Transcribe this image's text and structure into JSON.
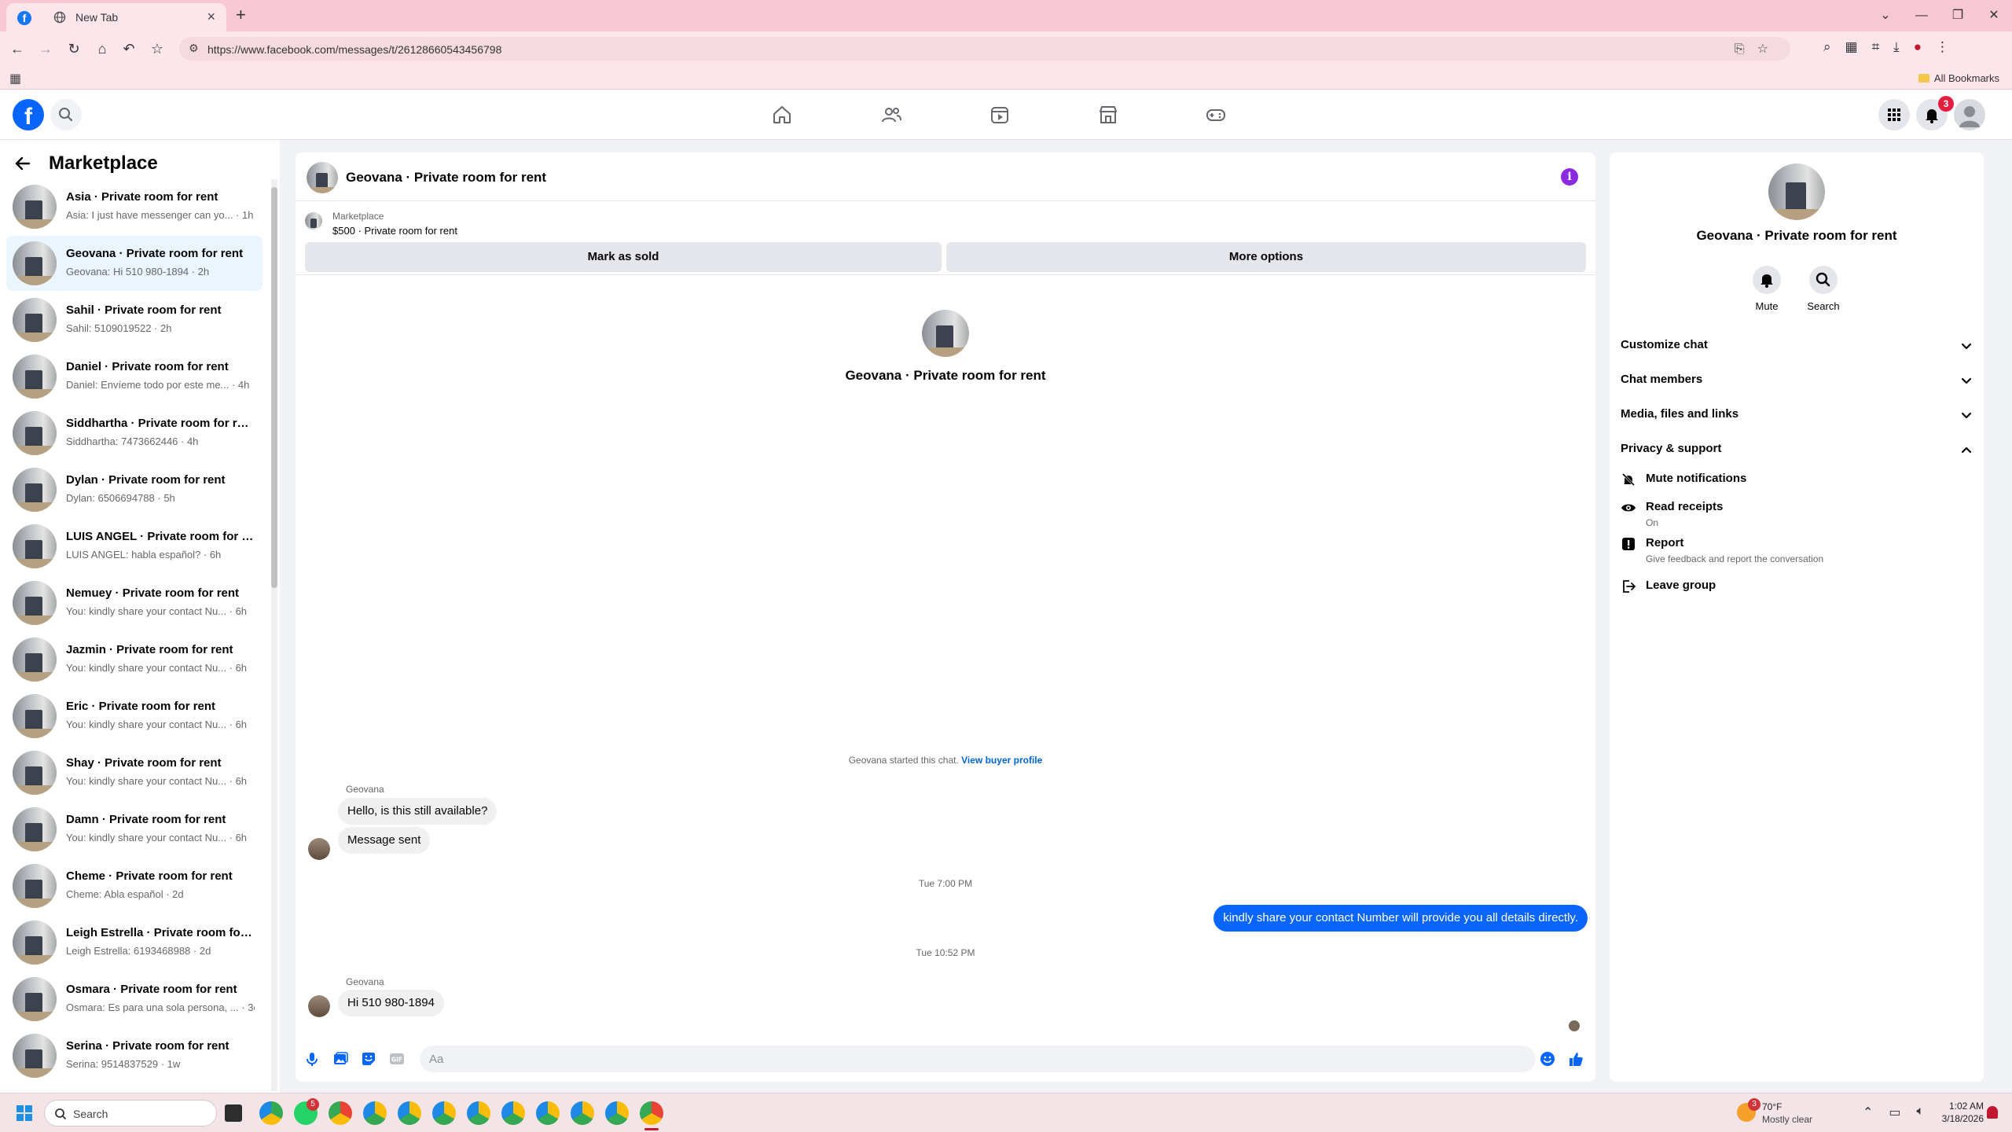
{
  "browser": {
    "tab_title": "New Tab",
    "url": "https://www.facebook.com/messages/t/26128660543456798",
    "all_bookmarks": "All Bookmarks",
    "accent": "#f8c9d4"
  },
  "facebook": {
    "brand_color": "#0866ff",
    "notification_count": "3"
  },
  "left": {
    "title": "Marketplace",
    "conversations": [
      {
        "name": "Asia · Private room for rent",
        "preview": "Asia: I just have messenger can yo... · 1h"
      },
      {
        "name": "Geovana · Private room for rent",
        "preview": "Geovana: Hi 510 980-1894 · 2h"
      },
      {
        "name": "Sahil · Private room for rent",
        "preview": "Sahil: 5109019522 · 2h"
      },
      {
        "name": "Daniel · Private room for rent",
        "preview": "Daniel: Envíeme todo por este me... · 4h"
      },
      {
        "name": "Siddhartha · Private room for rent",
        "preview": "Siddhartha: 7473662446 · 4h"
      },
      {
        "name": "Dylan · Private room for rent",
        "preview": "Dylan: 6506694788 · 5h"
      },
      {
        "name": "LUIS ANGEL · Private room for r...",
        "preview": "LUIS ANGEL: habla español? · 6h"
      },
      {
        "name": "Nemuey · Private room for rent",
        "preview": "You: kindly share your contact Nu... · 6h"
      },
      {
        "name": "Jazmin · Private room for rent",
        "preview": "You: kindly share your contact Nu... · 6h"
      },
      {
        "name": "Eric · Private room for rent",
        "preview": "You: kindly share your contact Nu... · 6h"
      },
      {
        "name": "Shay · Private room for rent",
        "preview": "You: kindly share your contact Nu... · 6h"
      },
      {
        "name": "Damn · Private room for rent",
        "preview": "You: kindly share your contact Nu... · 6h"
      },
      {
        "name": "Cheme · Private room for rent",
        "preview": "Cheme: Abla español · 2d"
      },
      {
        "name": "Leigh Estrella · Private room for ...",
        "preview": "Leigh Estrella: 6193468988 · 2d"
      },
      {
        "name": "Osmara · Private room for rent",
        "preview": "Osmara: Es para una sola persona, ... · 3d"
      },
      {
        "name": "Serina · Private room for rent",
        "preview": "Serina: 9514837529 · 1w"
      }
    ]
  },
  "chat": {
    "title": "Geovana · Private room for rent",
    "listing_source": "Marketplace",
    "listing_price": "$500 · Private room for rent",
    "mark_sold": "Mark as sold",
    "more_options": "More options",
    "center_name": "Geovana · Private room for rent",
    "started_text": "Geovana started this chat.",
    "view_profile": "View buyer profile",
    "sender1": "Geovana",
    "msg1": "Hello, is this still available?",
    "msg2": "Message sent",
    "ts1": "Tue 7:00 PM",
    "msg3": "kindly share your contact Number will provide you all details directly.",
    "ts2": "Tue 10:52 PM",
    "sender2": "Geovana",
    "msg4": "Hi 510 980-1894",
    "placeholder": "Aa"
  },
  "right": {
    "name": "Geovana · Private room for rent",
    "mute": "Mute",
    "search": "Search",
    "sections": [
      "Customize chat",
      "Chat members",
      "Media, files and links",
      "Privacy & support"
    ],
    "options": [
      {
        "label": "Mute notifications",
        "sub": "",
        "icon": "bell-off-icon"
      },
      {
        "label": "Read receipts",
        "sub": "On",
        "icon": "eye-icon"
      },
      {
        "label": "Report",
        "sub": "Give feedback and report the conversation",
        "icon": "report-icon"
      },
      {
        "label": "Leave group",
        "sub": "",
        "icon": "leave-icon"
      }
    ]
  },
  "taskbar": {
    "search": "Search",
    "weather_temp": "70°F",
    "weather_desc": "Mostly clear",
    "time": "1:02 AM",
    "date": "3/18/2026",
    "whatsapp_badge": "5",
    "weather_badge": "3"
  }
}
